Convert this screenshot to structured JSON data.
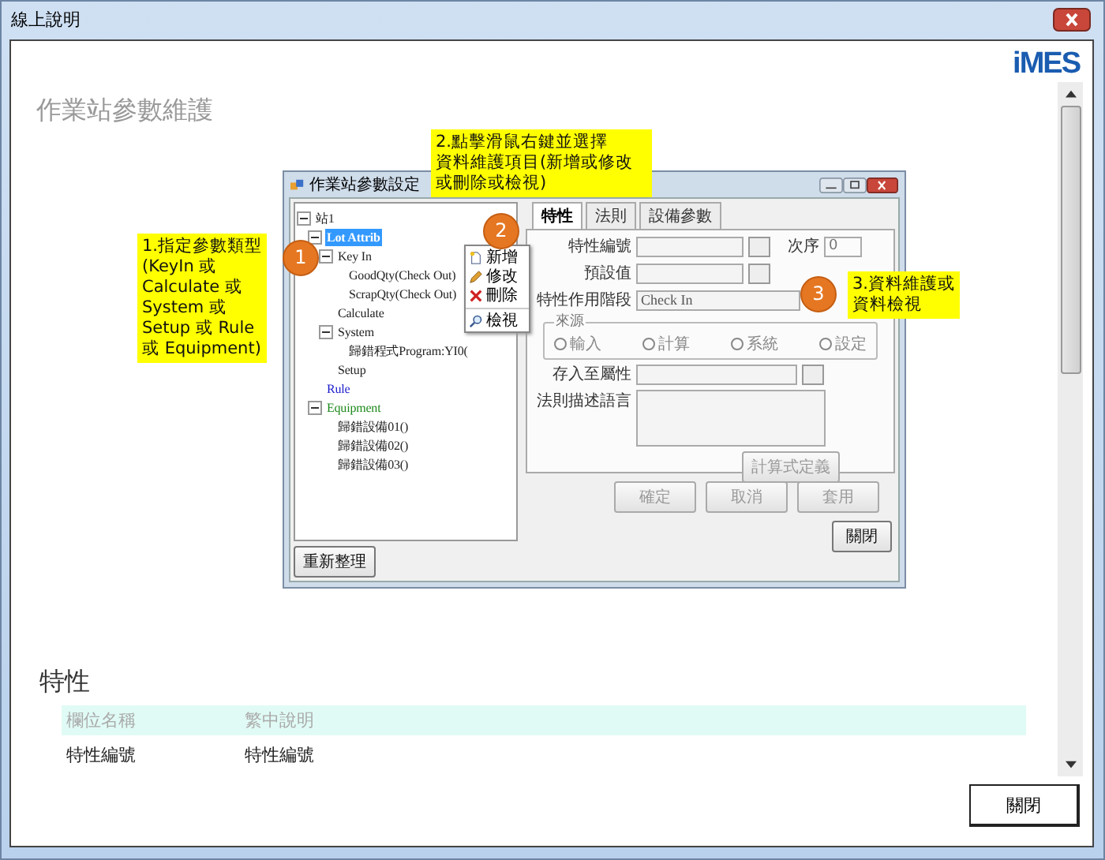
{
  "window": {
    "title": "線上說明"
  },
  "logo": {
    "text": "iMES"
  },
  "heading": "作業站參數維護",
  "figure": {
    "callouts": [
      {
        "number": "1",
        "lines": [
          "1.指定參數類型",
          "(KeyIn 或",
          "Calculate 或",
          "System 或",
          "Setup 或 Rule",
          "或 Equipment)"
        ]
      },
      {
        "number": "2",
        "lines": [
          "2.點擊滑鼠右鍵並選擇",
          "資料維護項目(新增或修改",
          "或刪除或檢視)"
        ]
      },
      {
        "number": "3",
        "lines": [
          "3.資料維護或",
          "資料檢視"
        ]
      }
    ],
    "app_window": {
      "title": "作業站參數設定",
      "tree": [
        {
          "label": "站1",
          "selected": false,
          "expanded": true,
          "children": [
            {
              "label": "Lot Attrib",
              "selected": true,
              "expanded": true,
              "children": [
                {
                  "label": "Key In",
                  "selected": false,
                  "expanded": true,
                  "children": [
                    {
                      "label": "GoodQty(Check Out)",
                      "selected": false
                    },
                    {
                      "label": "ScrapQty(Check Out)",
                      "selected": false
                    }
                  ]
                },
                {
                  "label": "Calculate",
                  "selected": false
                },
                {
                  "label": "System",
                  "selected": false,
                  "expanded": true,
                  "children": [
                    {
                      "label": "歸錯程式Program:YI0(",
                      "selected": false
                    }
                  ]
                },
                {
                  "label": "Setup",
                  "selected": false
                }
              ]
            },
            {
              "label": "Rule",
              "selected": false,
              "color": "#1a1acc"
            },
            {
              "label": "Equipment",
              "selected": false,
              "color": "#1c8a1c",
              "expanded": true,
              "children": [
                {
                  "label": "歸錯設備01()",
                  "selected": false
                },
                {
                  "label": "歸錯設備02()",
                  "selected": false
                },
                {
                  "label": "歸錯設備03()",
                  "selected": false
                }
              ]
            }
          ]
        }
      ],
      "context_menu": [
        {
          "label": "新增",
          "kind": "new"
        },
        {
          "label": "修改",
          "kind": "edit"
        },
        {
          "label": "刪除",
          "kind": "delete"
        },
        {
          "label": "檢視",
          "kind": "view"
        }
      ],
      "refresh_button": "重新整理",
      "tabs": [
        {
          "label": "特性",
          "selected": true
        },
        {
          "label": "法則",
          "selected": false
        },
        {
          "label": "設備參數",
          "selected": false
        }
      ],
      "form": {
        "id_label": "特性編號",
        "order_label": "次序",
        "order_value": "0",
        "default_label": "預設值",
        "stage_label": "特性作用階段",
        "stage_value": "Check In",
        "source": {
          "legend": "來源",
          "options": [
            {
              "label": "輸入",
              "selected": false
            },
            {
              "label": "計算",
              "selected": false
            },
            {
              "label": "系統",
              "selected": false
            },
            {
              "label": "設定",
              "selected": false
            }
          ]
        },
        "store_label": "存入至屬性",
        "rule_label": "法則描述語言"
      },
      "formula_button": {
        "label": "計算式定義",
        "disabled": true
      },
      "buttons": [
        {
          "label": "確定",
          "disabled": true
        },
        {
          "label": "取消",
          "disabled": true
        },
        {
          "label": "套用",
          "disabled": true
        }
      ],
      "close_button": "關閉"
    }
  },
  "section": {
    "heading": "特性",
    "columns": [
      "欄位名稱",
      "繁中說明"
    ],
    "rows": [
      [
        "特性編號",
        "特性編號"
      ]
    ]
  },
  "close_button": "關閉"
}
